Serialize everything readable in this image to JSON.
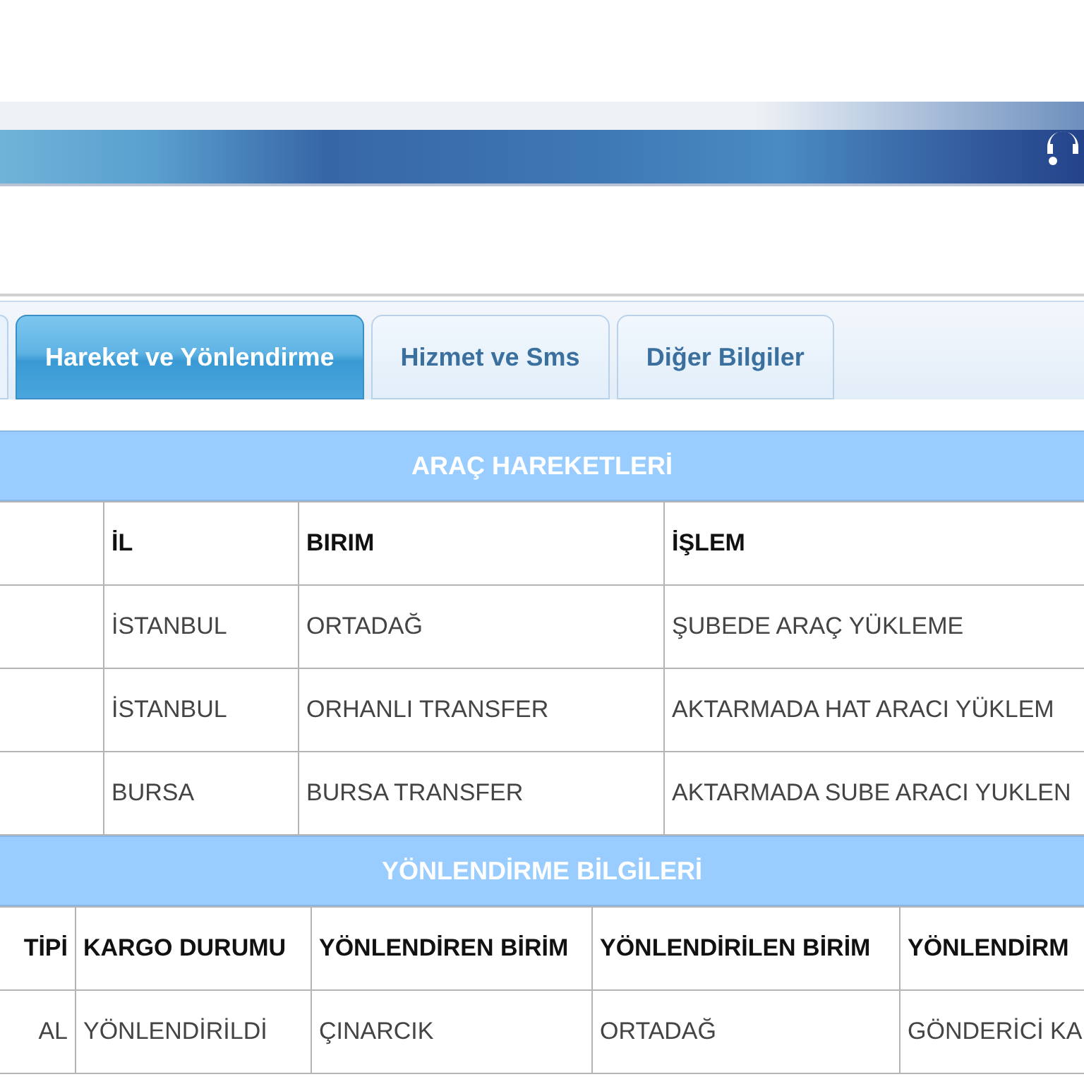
{
  "tabs": [
    {
      "kind": "edge",
      "selected": false
    },
    {
      "kind": "tab",
      "label": "Hareket ve Yönlendirme",
      "selected": true
    },
    {
      "kind": "tab",
      "label": "Hizmet ve Sms",
      "selected": false
    },
    {
      "kind": "tab",
      "label": "Diğer Bilgiler",
      "selected": false
    }
  ],
  "sections": [
    {
      "title": "ARAÇ HAREKETLERİ",
      "columns": [
        "İL",
        "BIRIM",
        "İŞLEM"
      ],
      "rows": [
        [
          "İSTANBUL",
          "ORTADAĞ",
          "ŞUBEDE ARAÇ YÜKLEME"
        ],
        [
          "İSTANBUL",
          "ORHANLI TRANSFER",
          "AKTARMADA HAT ARACI YÜKLEM"
        ],
        [
          "BURSA",
          "BURSA TRANSFER",
          "AKTARMADA SUBE ARACI YUKLEN"
        ]
      ]
    },
    {
      "title": "YÖNLENDİRME BİLGİLERİ",
      "columns": [
        "TİPİ",
        "KARGO DURUMU",
        "YÖNLENDİREN BİRİM",
        "YÖNLENDİRİLEN BİRİM",
        "YÖNLENDİRM"
      ],
      "rows": [
        [
          "AL",
          "YÖNLENDİRİLDİ",
          "ÇINARCIK",
          "ORTADAĞ",
          "GÖNDERİCİ KA"
        ]
      ]
    }
  ]
}
